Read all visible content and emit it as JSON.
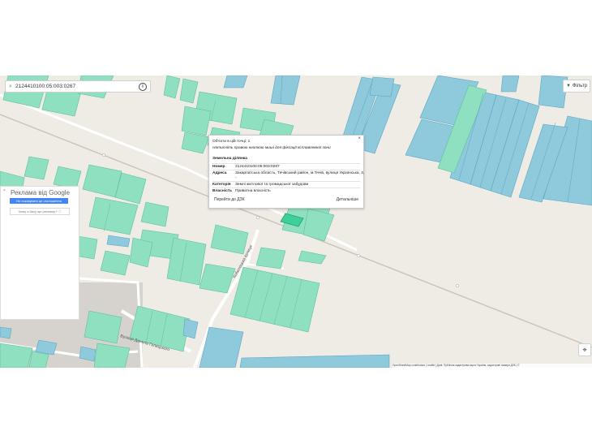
{
  "search": {
    "value": "2124410100:05:003:0267"
  },
  "filter": {
    "label": "Фільтр"
  },
  "popup": {
    "header": "Об'єкти в цій точці: 1",
    "hint": "Натисніть правою кнопкою миші для фіксації ксплавлевної зони",
    "section": "Земельна ділянка",
    "rows": [
      {
        "label": "Номер",
        "value": "2124410100:05:003:0267"
      },
      {
        "label": "Адреса",
        "value": "Закарпатська область, Тячівський район, м.Тячів, вулиця Українська, 3,"
      },
      {
        "label": "",
        "value": "-"
      },
      {
        "label": "Категорія",
        "value": "Землі житлової та громадської забудови"
      },
      {
        "label": "Власність",
        "value": "Приватна власність"
      }
    ],
    "link_left": "Перейти до ДЗК",
    "link_right": "Детальніше",
    "close": "×"
  },
  "ad": {
    "title": "Реклама від Google",
    "close": "×",
    "button": "Не показувати це оголошення",
    "why": "Чому я бачу цю рекламу? ⓘ"
  },
  "streets": {
    "street_1": "Кобилецька вулиця",
    "street_2": "Вулиця Данила Галицького"
  },
  "attribution": "OpenStreetMap contributors | Leaflet | Дані: Публічна кадастрова карта України, кадастрові номери ДЗК | ©",
  "colors": {
    "parcel_green": "#8fe0c0",
    "parcel_green_stroke": "#5fbf9a",
    "parcel_blue": "#8ec9dc",
    "parcel_blue_stroke": "#5aa6c2",
    "selected_parcel": "#3fcf98",
    "map_background": "#efece6",
    "road": "#ffffff",
    "railway": "#c9c3b8"
  },
  "icons": {
    "search": "search-icon",
    "info": "info-icon",
    "filter": "funnel-icon",
    "locate": "crosshair-icon"
  }
}
